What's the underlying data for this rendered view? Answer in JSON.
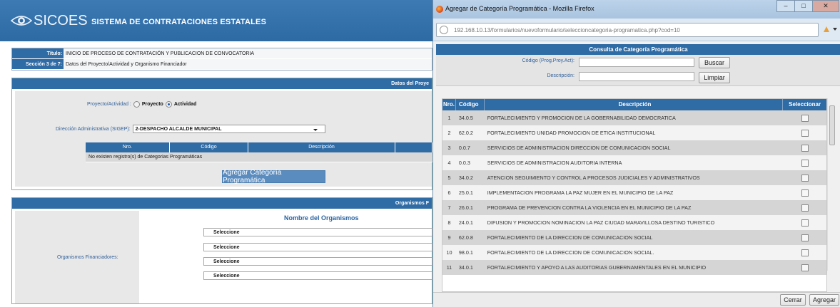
{
  "main": {
    "brand": "SICOES",
    "system_title": "SISTEMA DE CONTRATACIONES ESTATALES",
    "info": [
      {
        "label": "Título:",
        "value": "INICIO DE PROCESO DE CONTRATACIÓN Y PUBLICACION DE CONVOCATORIA"
      },
      {
        "label": "Sección 3 de 7:",
        "value": "Datos del Proyecto/Actividad y Organismo Financiador"
      }
    ],
    "datos_header": "Datos del Proye",
    "proyecto_label": "Proyecto/Actividad :",
    "radio_proyecto": "Proyecto",
    "radio_actividad": "Actividad",
    "direccion_label": "Dirección Administrativa (SIGEP):",
    "direccion_value": "2-DESPACHO ALCALDE MUNICIPAL",
    "cat_cols": [
      "Nro.",
      "Código",
      "Descripción"
    ],
    "cat_empty": "No existen registro(s) de Categorias Programáticas",
    "btn_add": "Agregar Categoría Programática",
    "org_header": "Organismos F",
    "org_col": "Nombre del Organismos",
    "org_label": "Organismos Financiadores:",
    "org_selects": [
      "Seleccione",
      "Seleccione",
      "Seleccione",
      "Seleccione"
    ]
  },
  "popup": {
    "title": "Agregar de Categoría Programática - Mozilla Firefox",
    "url": "192.168.10.13/formularios/nuevoformulario/seleccioncategoria-programatica.php?cod=10",
    "consulta_title": "Consulta de Categoría Programática",
    "codigo_label": "Código (Prog.Proy.Act):",
    "descripcion_label": "Descripción:",
    "btn_buscar": "Buscar",
    "btn_limpiar": "Limpiar",
    "cols": [
      "Nro.",
      "Código",
      "Descripción",
      "Seleccionar"
    ],
    "rows": [
      {
        "n": "1",
        "c": "34.0.5",
        "d": "FORTALECIMIENTO Y PROMOCION DE LA GOBERNABILIDAD DEMOCRATICA"
      },
      {
        "n": "2",
        "c": "62.0.2",
        "d": "FORTALECIMIENTO UNIDAD PROMOCION DE ETICA INSTITUCIONAL"
      },
      {
        "n": "3",
        "c": "0.0.7",
        "d": "SERVICIOS DE ADMINISTRACION DIRECCION DE COMUNICACION SOCIAL"
      },
      {
        "n": "4",
        "c": "0.0.3",
        "d": "SERVICIOS DE ADMINISTRACION AUDITORIA INTERNA"
      },
      {
        "n": "5",
        "c": "34.0.2",
        "d": "ATENCION SEGUIMIENTO Y CONTROL A PROCESOS JUDICIALES Y ADMINISTRATIVOS"
      },
      {
        "n": "6",
        "c": "25.0.1",
        "d": "IMPLEMENTACION PROGRAMA LA PAZ MUJER EN EL MUNICIPIO DE LA PAZ"
      },
      {
        "n": "7",
        "c": "26.0.1",
        "d": "PROGRAMA DE PREVENCION CONTRA LA VIOLENCIA EN EL MUNICIPIO DE LA PAZ"
      },
      {
        "n": "8",
        "c": "24.0.1",
        "d": "DIFUSION Y PROMOCION NOMINACION LA PAZ CIUDAD MARAVILLOSA DESTINO TURISTICO"
      },
      {
        "n": "9",
        "c": "62.0.8",
        "d": "FORTALECIMIENTO DE LA DIRECCION DE COMUNICACION SOCIAL"
      },
      {
        "n": "10",
        "c": "98.0.1",
        "d": "FORTALECIMIENTO DE LA DIRECCION DE COMUNICACION SOCIAL."
      },
      {
        "n": "11",
        "c": "34.0.1",
        "d": "FORTALECIMIENTO Y APOYO A LAS AUDITORIAS GUBERNAMENTALES EN EL MUNICIPIO"
      }
    ],
    "btn_cerrar": "Cerrar",
    "btn_agregar": "Agregar"
  }
}
